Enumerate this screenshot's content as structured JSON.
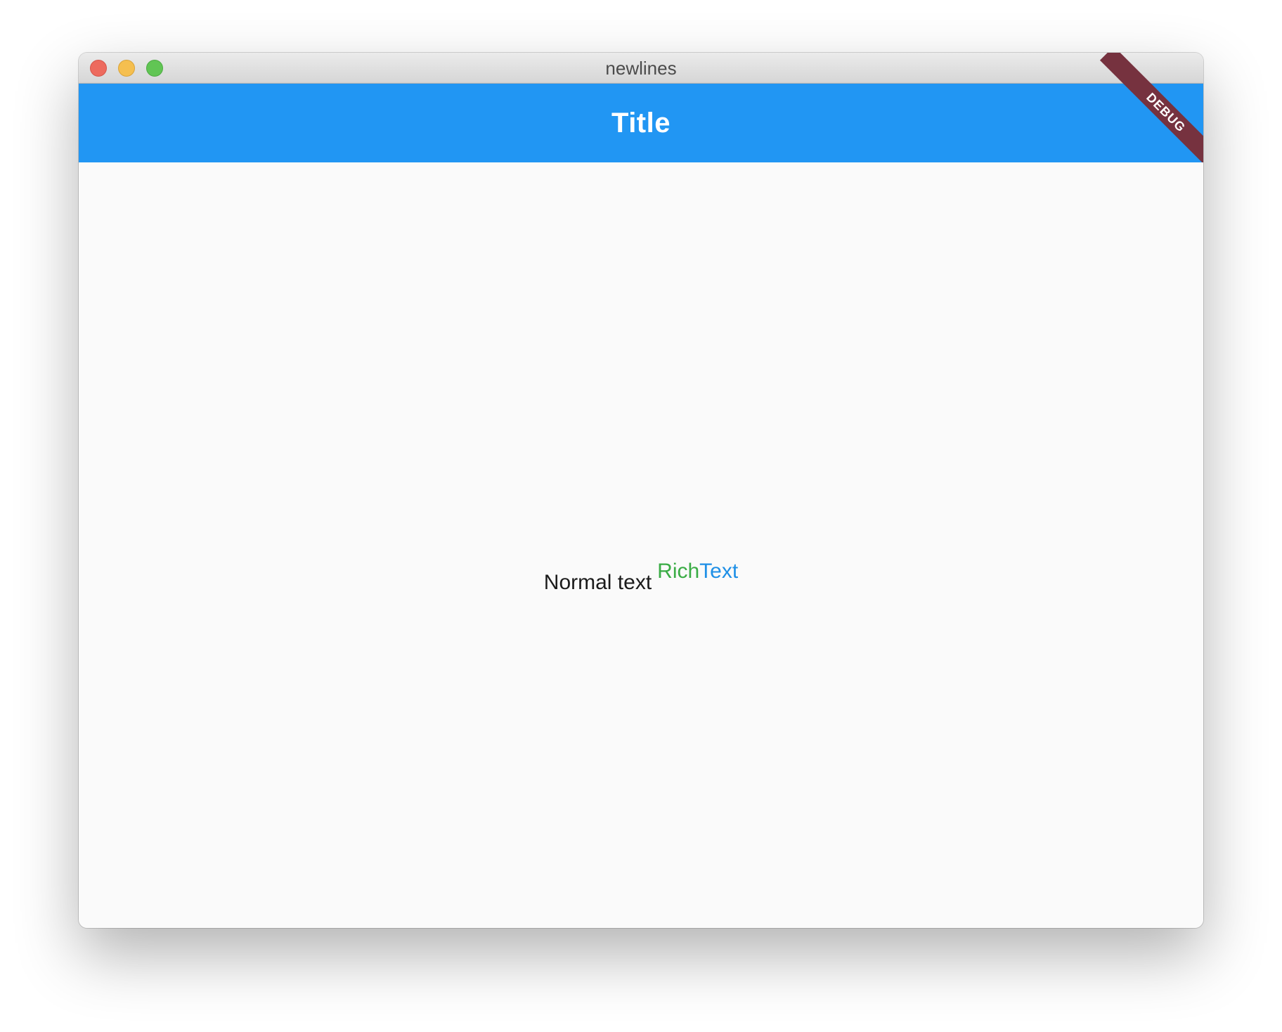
{
  "window": {
    "title": "newlines",
    "controls": {
      "close": "close-button",
      "minimize": "minimize-button",
      "maximize": "maximize-button"
    }
  },
  "appbar": {
    "title": "Title",
    "background_color": "#2196f3"
  },
  "debug_banner": {
    "label": "DEBUG",
    "color": "#76323f"
  },
  "content": {
    "normal_text": "Normal text",
    "rich_text": {
      "part1": "Rich",
      "part1_color": "#3aac45",
      "part2": "Text",
      "part2_color": "#1e8fe6"
    }
  }
}
